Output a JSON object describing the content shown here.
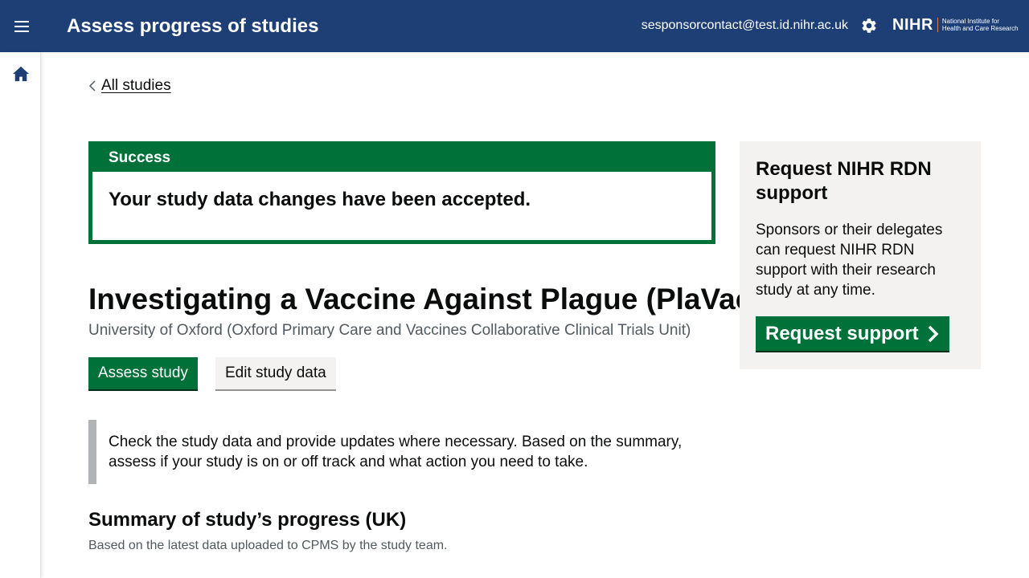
{
  "header": {
    "title": "Assess progress of studies",
    "user_email": "sesponsorcontact@test.id.nihr.ac.uk",
    "logo_mark": "NIHR",
    "logo_text": "National Institute for Health and Care Research",
    "menu_icon": "hamburger-menu-icon",
    "settings_icon": "gear-icon"
  },
  "sidebar": {
    "home_icon": "home-icon"
  },
  "breadcrumb": {
    "back_label": "All studies"
  },
  "notification": {
    "title": "Success",
    "message": "Your study data changes have been accepted."
  },
  "study": {
    "title": "Investigating a Vaccine Against Plague (PlaVac)",
    "organisation": "University of Oxford (Oxford Primary Care and Vaccines Collaborative Clinical Trials Unit)",
    "assess_button": "Assess study",
    "edit_button": "Edit study data",
    "inset_text": "Check the study data and provide updates where necessary. Based on the summary, assess if your study is on or off track and what action you need to take."
  },
  "summary": {
    "title": "Summary of study’s progress (UK)",
    "subtitle": "Based on the latest data uploaded to CPMS by the study team."
  },
  "support_panel": {
    "title": "Request NIHR RDN support",
    "text": "Sponsors or their delegates can request NIHR RDN support with their research study at any time.",
    "button": "Request support"
  },
  "colors": {
    "header_bg": "#1d3f76",
    "primary_green": "#007139",
    "panel_grey": "#f3f2f1",
    "inset_border": "#b1b4b6"
  }
}
